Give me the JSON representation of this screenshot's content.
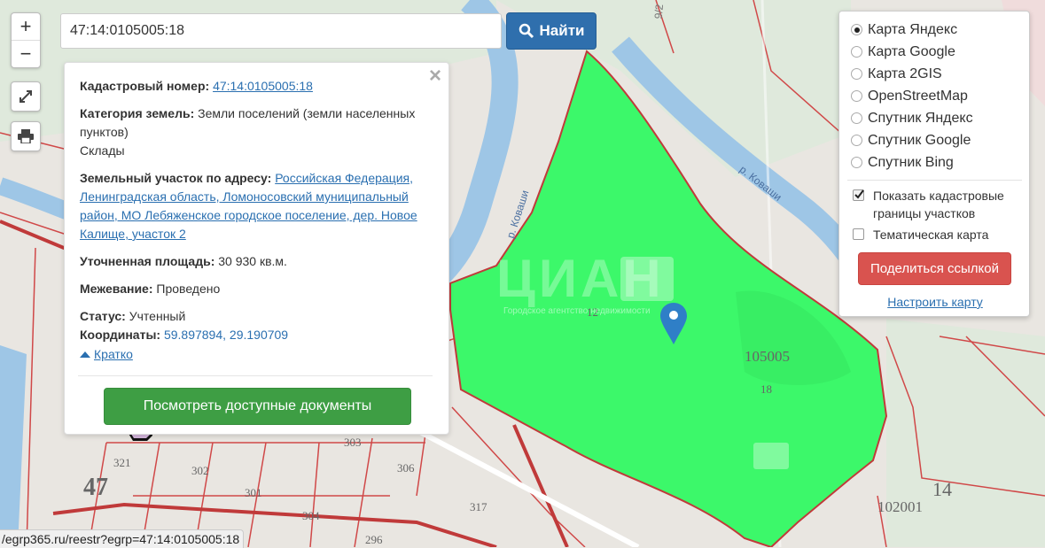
{
  "search": {
    "value": "47:14:0105005:18",
    "button_label": "Найти"
  },
  "zoom": {
    "in_label": "+",
    "out_label": "−"
  },
  "popup": {
    "cadastral_label": "Кадастровый номер:",
    "cadastral_value": "47:14:0105005:18",
    "category_label": "Категория земель:",
    "category_value": "Земли поселений (земли населенных пунктов)",
    "category_extra": "Склады",
    "address_label": "Земельный участок по адресу:",
    "address_value": "Российская Федерация, Ленинградская область, Ломоносовский муниципальный район, МО Лебяженское городское поселение, дер. Новое Калище, участок 2",
    "area_label": "Уточненная площадь:",
    "area_value": "30 930 кв.м.",
    "survey_label": "Межевание:",
    "survey_value": "Проведено",
    "status_label": "Статус:",
    "status_value": "Учтенный",
    "coords_label": "Координаты:",
    "coords_value": "59.897894, 29.190709",
    "brief_label": "Кратко",
    "docs_button": "Посмотреть доступные документы"
  },
  "layers": {
    "options": [
      {
        "label": "Карта Яндекс",
        "selected": true
      },
      {
        "label": "Карта Google",
        "selected": false
      },
      {
        "label": "Карта 2GIS",
        "selected": false
      },
      {
        "label": "OpenStreetMap",
        "selected": false
      },
      {
        "label": "Спутник Яндекс",
        "selected": false
      },
      {
        "label": "Спутник Google",
        "selected": false
      },
      {
        "label": "Спутник Bing",
        "selected": false
      }
    ],
    "show_borders_label": "Показать кадастровые границы участков",
    "show_borders_checked": true,
    "thematic_label": "Тематическая карта",
    "thematic_checked": false,
    "share_button": "Поделиться ссылкой",
    "configure_link": "Настроить карту"
  },
  "map": {
    "labels": [
      "47",
      "14",
      "105005",
      "102001",
      "18",
      "12",
      "303",
      "306",
      "302",
      "301",
      "304",
      "317",
      "321",
      "296"
    ],
    "river_labels": [
      "р. Коваши",
      "р. Коваши"
    ],
    "road_label": "9/2",
    "watermark": "ЦИАН",
    "watermark_sub": "Городское агентство недвижимости",
    "colors": {
      "parcel": "#3cf86a",
      "border": "#d04848",
      "water": "#9ec6e6",
      "land": "#e9e6e1"
    }
  },
  "statusbar": {
    "url": "/egrp365.ru/reestr?egrp=47:14:0105005:18"
  }
}
